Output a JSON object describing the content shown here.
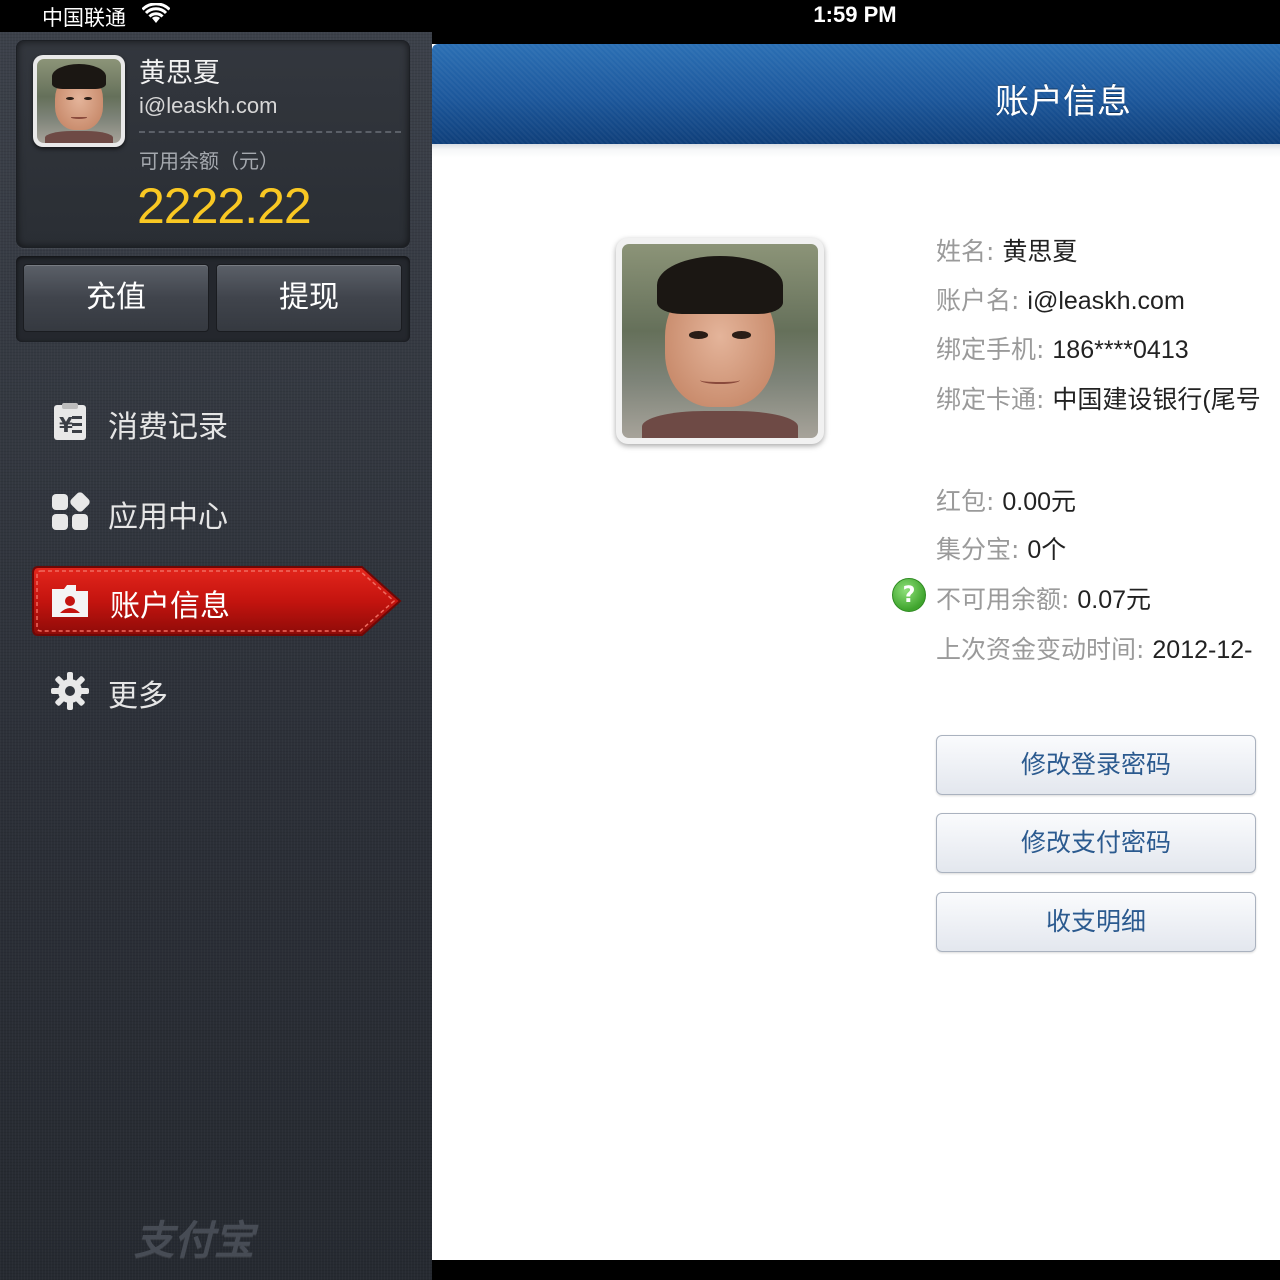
{
  "status_bar": {
    "carrier": "中国联通",
    "time": "1:59 PM"
  },
  "sidebar": {
    "user": {
      "name": "黄思夏",
      "email": "i@leaskh.com",
      "balance_label": "可用余额（元）",
      "balance": "2222.22"
    },
    "actions": {
      "recharge": "充值",
      "withdraw": "提现"
    },
    "nav": [
      {
        "label": "消费记录",
        "icon": "receipt-icon",
        "active": false
      },
      {
        "label": "应用中心",
        "icon": "apps-grid-icon",
        "active": false
      },
      {
        "label": "账户信息",
        "icon": "account-folder-icon",
        "active": true
      },
      {
        "label": "更多",
        "icon": "gear-icon",
        "active": false
      }
    ],
    "logo": "支付宝"
  },
  "main": {
    "title": "账户信息",
    "profile": [
      {
        "key": "姓名:",
        "value": "黄思夏"
      },
      {
        "key": "账户名:",
        "value": "i@leaskh.com"
      },
      {
        "key": "绑定手机:",
        "value": "186****0413"
      },
      {
        "key": "绑定卡通:",
        "value": "中国建设银行(尾号"
      }
    ],
    "funds": [
      {
        "key": "红包:",
        "value": "0.00元"
      },
      {
        "key": "集分宝:",
        "value": "0个"
      },
      {
        "key": "不可用余额:",
        "value": "0.07元"
      },
      {
        "key": "上次资金变动时间:",
        "value": "2012-12-"
      }
    ],
    "help_glyph": "?",
    "buttons": {
      "change_login_password": "修改登录密码",
      "change_pay_password": "修改支付密码",
      "statements": "收支明细"
    }
  },
  "colors": {
    "accent_red": "#c4140f",
    "header_blue": "#1c579b",
    "balance_yellow": "#f9c823"
  }
}
